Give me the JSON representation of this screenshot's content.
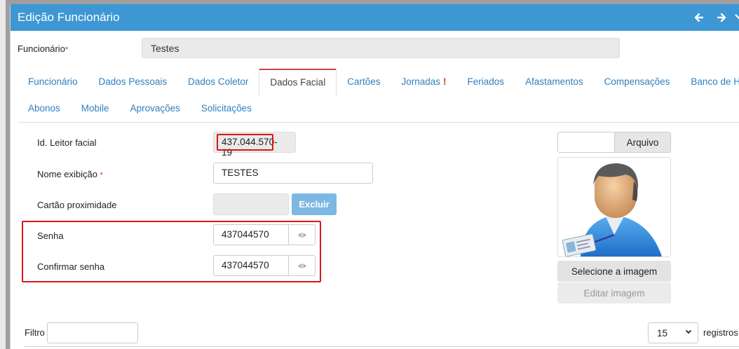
{
  "modal": {
    "title": "Edição Funcionário",
    "prev_icon": "arrow-left-icon",
    "next_icon": "arrow-right-icon"
  },
  "funcionario": {
    "label": "Funcionário",
    "required_mark": "*",
    "value": "Testes"
  },
  "tabs": {
    "row1": [
      {
        "label": "Funcionário",
        "active": false
      },
      {
        "label": "Dados Pessoais",
        "active": false
      },
      {
        "label": "Dados Coletor",
        "active": false
      },
      {
        "label": "Dados Facial",
        "active": true
      },
      {
        "label": "Cartões",
        "active": false
      },
      {
        "label": "Jornadas",
        "active": false,
        "badge": "!"
      },
      {
        "label": "Feriados",
        "active": false
      },
      {
        "label": "Afastamentos",
        "active": false
      },
      {
        "label": "Compensações",
        "active": false
      },
      {
        "label": "Banco de Horas",
        "active": false
      }
    ],
    "row2": [
      {
        "label": "Abonos"
      },
      {
        "label": "Mobile"
      },
      {
        "label": "Aprovações"
      },
      {
        "label": "Solicitações"
      }
    ]
  },
  "form": {
    "id_leitor": {
      "label": "Id. Leitor facial",
      "value": "437.044.570-19"
    },
    "nome_exibicao": {
      "label": "Nome exibição",
      "required_mark": "*",
      "value": "TESTES"
    },
    "cartao": {
      "label": "Cartão proximidade",
      "value": "",
      "delete_label": "Excluir"
    },
    "senha": {
      "label": "Senha",
      "value": "437044570"
    },
    "confirmar": {
      "label": "Confirmar senha",
      "value": "437044570"
    }
  },
  "photo": {
    "file_button": "Arquivo",
    "select_button": "Selecione a imagem",
    "edit_button": "Editar imagem"
  },
  "table_controls": {
    "filter_label": "Filtro",
    "page_size": "15",
    "records_label": "registros"
  },
  "colors": {
    "header": "#3d97d4",
    "link": "#2f7fbf",
    "highlight": "#d81818",
    "disabled_button": "#7db8e3"
  }
}
